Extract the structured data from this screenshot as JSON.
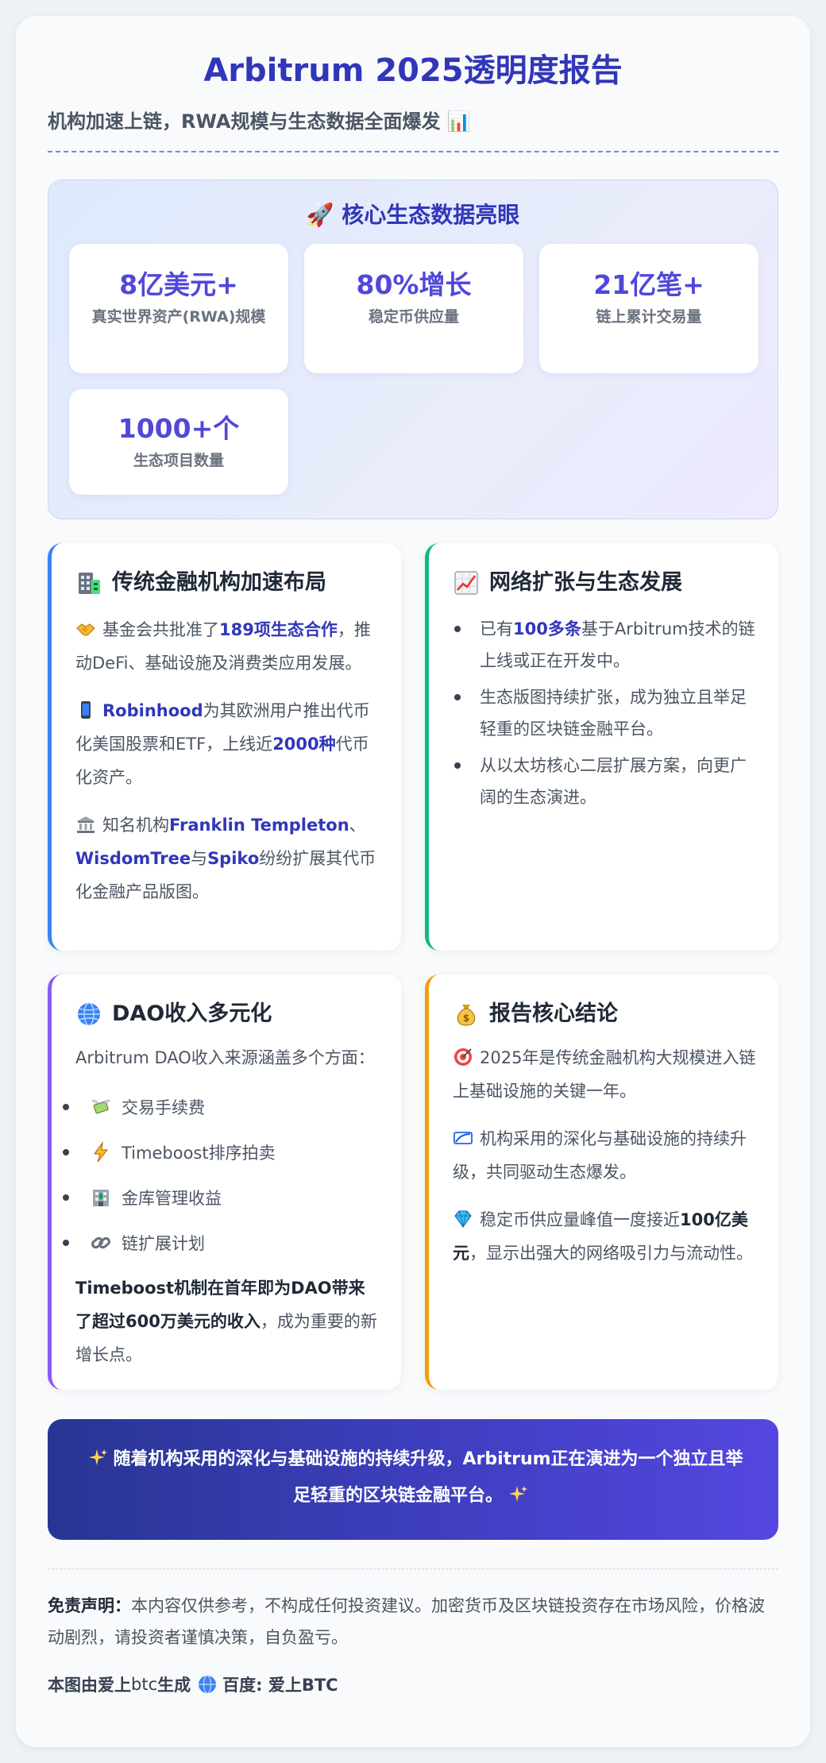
{
  "header": {
    "title": "Arbitrum 2025透明度报告",
    "subtitle": "机构加速上链，RWA规模与生态数据全面爆发 📊"
  },
  "hero": {
    "title": "🚀 核心生态数据亮眼",
    "stats": [
      {
        "value": "8亿美元+",
        "label": "真实世界资产(RWA)规模"
      },
      {
        "value": "80%增长",
        "label": "稳定币供应量"
      },
      {
        "value": "21亿笔+",
        "label": "链上累计交易量"
      },
      {
        "value": "1000+个",
        "label": "生态项目数量"
      }
    ]
  },
  "institutions": {
    "title": "传统金融机构加速布局",
    "icon": "office-building-icon",
    "p1": {
      "pre": "基金会共批准了",
      "hl": "189项生态合作",
      "post": "，推动DeFi、基础设施及消费类应用发展。"
    },
    "p2": {
      "hl1": "Robinhood",
      "mid": "为其欧洲用户推出代币化美国股票和ETF，上线近",
      "hl2": "2000种",
      "post": "代币化资产。"
    },
    "p3": {
      "pre": "知名机构",
      "hl1": "Franklin Templeton",
      "sep1": "、",
      "hl2": "WisdomTree",
      "sep2": "与",
      "hl3": "Spiko",
      "post": "纷纷扩展其代币化金融产品版图。"
    }
  },
  "expansion": {
    "title": "网络扩张与生态发展",
    "icon": "chart-increasing-icon",
    "b1": {
      "pre": "已有",
      "hl": "100多条",
      "post": "基于Arbitrum技术的链上线或正在开发中。"
    },
    "b2": "生态版图持续扩张，成为独立且举足轻重的区块链金融平台。",
    "b3": "从以太坊核心二层扩展方案，向更广阔的生态演进。"
  },
  "dao": {
    "title": "DAO收入多元化",
    "icon": "globe-icon",
    "intro": "Arbitrum DAO收入来源涵盖多个方面：",
    "items": [
      {
        "label": "交易手续费",
        "icon": "money-with-wings-icon"
      },
      {
        "label": "Timeboost排序拍卖",
        "icon": "lightning-icon"
      },
      {
        "label": "金库管理收益",
        "icon": "bank-building-icon"
      },
      {
        "label": "链扩展计划",
        "icon": "chain-link-icon"
      }
    ],
    "summary_bold": "Timeboost机制在首年即为DAO带来了超过600万美元的收入",
    "summary_rest": "，成为重要的新增长点。"
  },
  "conclusion": {
    "title": "报告核心结论",
    "icon": "money-bag-icon",
    "c1": "2025年是传统金融机构大规模进入链上基础设施的关键一年。",
    "c2": "机构采用的深化与基础设施的持续升级，共同驱动生态爆发。",
    "c3": {
      "pre": "稳定币供应量峰值一度接近",
      "bold": "100亿美元",
      "post": "，显示出强大的网络吸引力与流动性。"
    }
  },
  "banner": {
    "text": "随着机构采用的深化与基础设施的持续升级，Arbitrum正在演进为一个独立且举足轻重的区块链金融平台。"
  },
  "footer": {
    "disclaimer_label": "免责声明：",
    "disclaimer_text": "本内容仅供参考，不构成任何投资建议。加密货币及区块链投资存在市场风险，价格波动剧烈，请投资者谨慎决策，自负盈亏。",
    "credit_a": "本图由爱上",
    "credit_b": "btc",
    "credit_c": "生成",
    "credit_d": "百度: 爱上BTC"
  },
  "colors": {
    "title": "#3137b8",
    "accent": "#5147d9",
    "border_blue": "#3b82f6",
    "border_green": "#10b981",
    "border_purple": "#8b5cf6",
    "border_orange": "#f59e0b"
  }
}
